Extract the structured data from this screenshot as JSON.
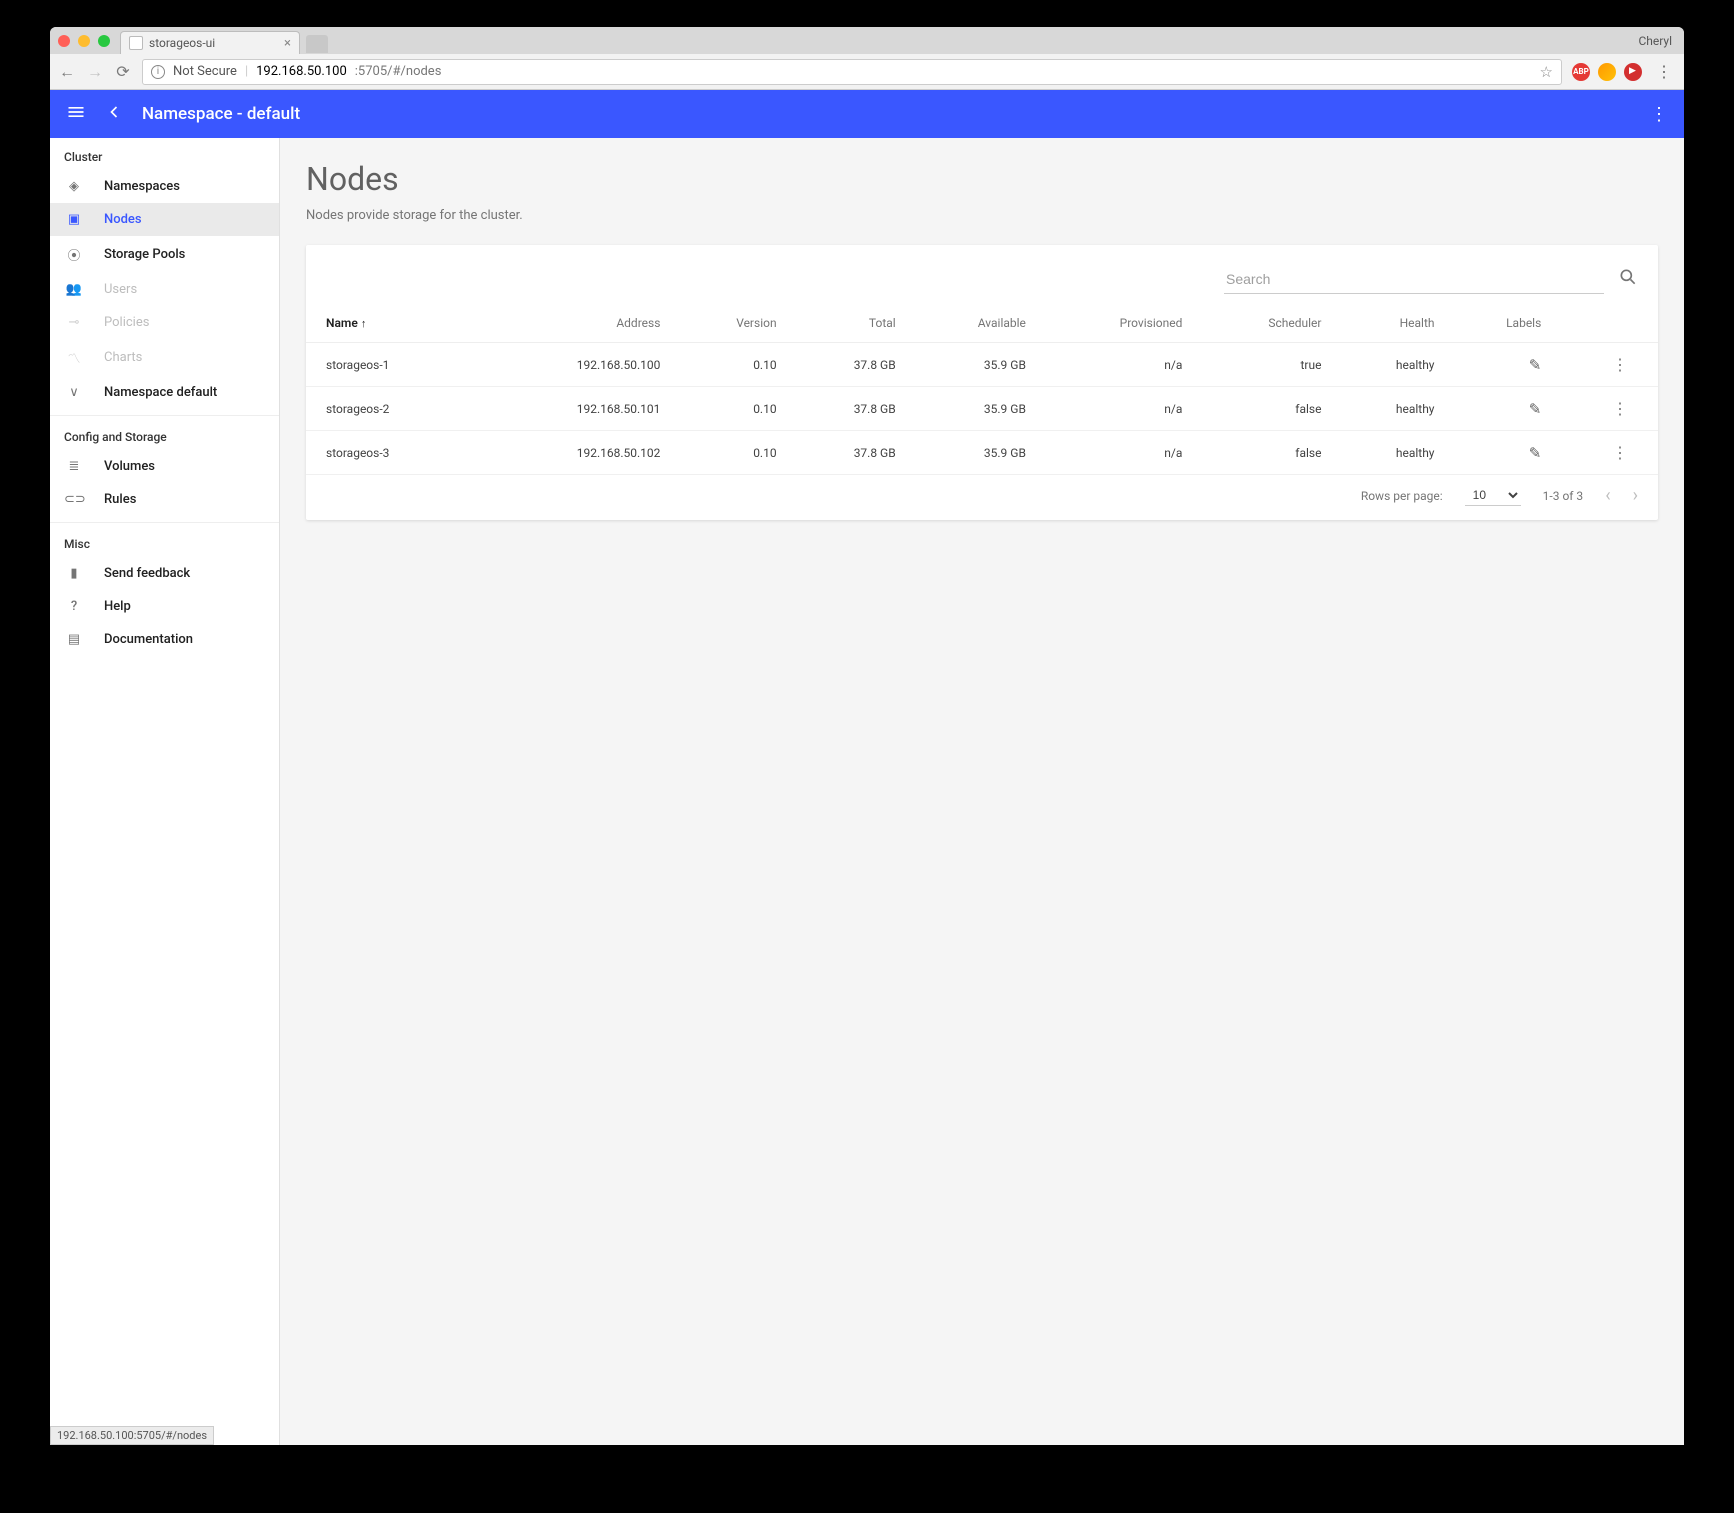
{
  "browser": {
    "tab_title": "storageos-ui",
    "profile": "Cheryl",
    "not_secure": "Not Secure",
    "url_host": "192.168.50.100",
    "url_rest": ":5705/#/nodes",
    "status_text": "192.168.50.100:5705/#/nodes"
  },
  "header": {
    "title": "Namespace - default"
  },
  "sidebar": {
    "sections": [
      {
        "title": "Cluster",
        "items": [
          {
            "icon": "layers",
            "label": "Namespaces",
            "muted": false
          },
          {
            "icon": "cube",
            "label": "Nodes",
            "muted": false,
            "active": true
          },
          {
            "icon": "pool",
            "label": "Storage Pools",
            "muted": false
          },
          {
            "icon": "users",
            "label": "Users",
            "muted": true
          },
          {
            "icon": "key",
            "label": "Policies",
            "muted": true
          },
          {
            "icon": "chart",
            "label": "Charts",
            "muted": true
          },
          {
            "icon": "chev",
            "label": "Namespace default",
            "muted": false
          }
        ]
      },
      {
        "title": "Config and Storage",
        "items": [
          {
            "icon": "vols",
            "label": "Volumes"
          },
          {
            "icon": "rules",
            "label": "Rules"
          }
        ]
      },
      {
        "title": "Misc",
        "items": [
          {
            "icon": "chat",
            "label": "Send feedback"
          },
          {
            "icon": "help",
            "label": "Help"
          },
          {
            "icon": "doc",
            "label": "Documentation"
          }
        ]
      }
    ]
  },
  "page": {
    "title": "Nodes",
    "subtitle": "Nodes provide storage for the cluster.",
    "search_placeholder": "Search"
  },
  "table": {
    "headers": [
      "Name",
      "Address",
      "Version",
      "Total",
      "Available",
      "Provisioned",
      "Scheduler",
      "Health",
      "Labels"
    ],
    "rows": [
      {
        "name": "storageos-1",
        "address": "192.168.50.100",
        "version": "0.10",
        "total": "37.8 GB",
        "available": "35.9 GB",
        "provisioned": "n/a",
        "scheduler": "true",
        "health": "healthy"
      },
      {
        "name": "storageos-2",
        "address": "192.168.50.101",
        "version": "0.10",
        "total": "37.8 GB",
        "available": "35.9 GB",
        "provisioned": "n/a",
        "scheduler": "false",
        "health": "healthy"
      },
      {
        "name": "storageos-3",
        "address": "192.168.50.102",
        "version": "0.10",
        "total": "37.8 GB",
        "available": "35.9 GB",
        "provisioned": "n/a",
        "scheduler": "false",
        "health": "healthy"
      }
    ]
  },
  "pager": {
    "rows_label": "Rows per page:",
    "per_page": "10",
    "range": "1-3 of 3"
  }
}
